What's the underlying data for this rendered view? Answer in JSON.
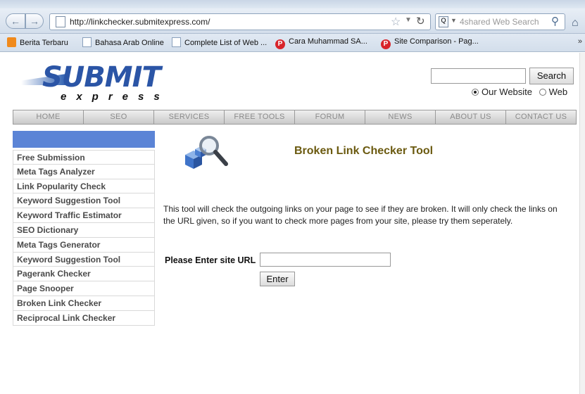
{
  "browser": {
    "url": "http://linkchecker.submitexpress.com/",
    "search_engine": "4shared Web Search",
    "bookmarks": [
      {
        "label": "Berita Terbaru",
        "icon": "rss-feed-icon"
      },
      {
        "label": "Bahasa Arab Online",
        "icon": "page-icon"
      },
      {
        "label": "Complete List of Web ...",
        "icon": "page-icon"
      },
      {
        "label": "Cara Muhammad SA...",
        "icon": "p-logo-icon"
      },
      {
        "label": "Site Comparison - Pag...",
        "icon": "p-logo-icon"
      }
    ],
    "bookmarks_more": "»"
  },
  "logo": {
    "main": "SUBMIT",
    "sub": "express"
  },
  "site_search": {
    "button": "Search",
    "options": [
      {
        "label": "Our Website",
        "selected": true
      },
      {
        "label": "Web",
        "selected": false
      }
    ]
  },
  "topnav": [
    "HOME",
    "SEO",
    "SERVICES",
    "FREE TOOLS",
    "FORUM",
    "NEWS",
    "ABOUT US",
    "CONTACT US"
  ],
  "sidebar": {
    "items": [
      "Free Submission",
      "Meta Tags Analyzer",
      "Link Popularity Check",
      "Keyword Suggestion Tool",
      "Keyword Traffic Estimator",
      "SEO Dictionary",
      "Meta Tags Generator",
      "Keyword Suggestion Tool",
      "Pagerank Checker",
      "Page Snooper",
      "Broken Link Checker",
      "Reciprocal Link Checker"
    ]
  },
  "main": {
    "title": "Broken Link Checker Tool",
    "description": "This tool will check the outgoing links on your page to see if they are broken. It will only check the links on the URL given, so if you want to check more pages from your site, please try them seperately.",
    "url_label": "Please Enter site URL",
    "url_value": "",
    "enter_button": "Enter"
  },
  "colors": {
    "brand_blue": "#2b55a6",
    "sidebar_header": "#5b84d6",
    "title_color": "#6b5a10"
  }
}
